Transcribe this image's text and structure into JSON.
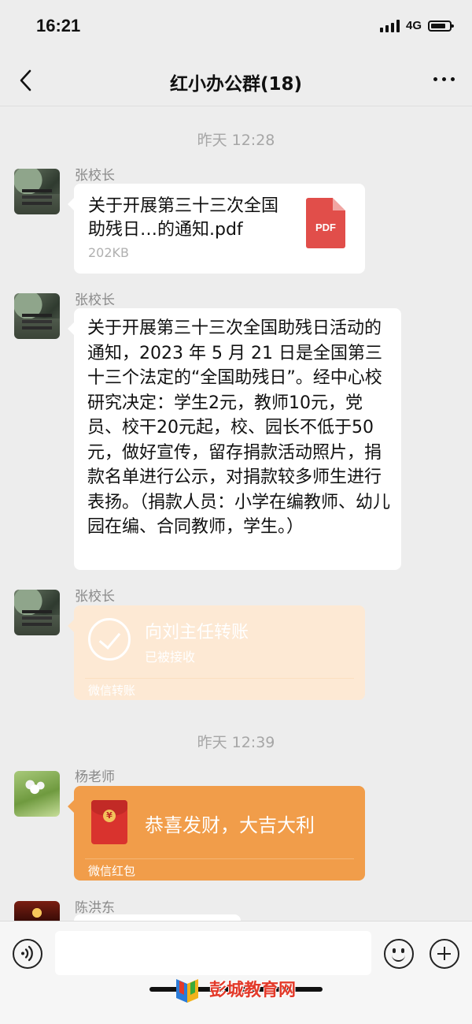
{
  "status_bar": {
    "time": "16:21",
    "network": "4G"
  },
  "header": {
    "title": "红小办公群(18)"
  },
  "messages": [
    {
      "type": "time",
      "text": "昨天 12:28"
    },
    {
      "type": "file",
      "sender": "张校长",
      "file_name": "关于开展第三十三次全国助残日…的通知.pdf",
      "file_size": "202KB",
      "file_icon_label": "PDF",
      "icon": "pdf-file-icon"
    },
    {
      "type": "text",
      "sender": "张校长",
      "text": "关于开展第三十三次全国助残日活动的通知，2023 年 5 月 21 日是全国第三十三个法定的“全国助残日”。经中心校研究决定：学生2元，教师10元，党员、校干20元起，校、园长不低于50元，做好宣传，留存捐款活动照片，捐款名单进行公示，对捐款较多师生进行表扬。（捐款人员：小学在编教师、幼儿园在编、合同教师，学生。）"
    },
    {
      "type": "transfer",
      "sender": "张校长",
      "title": "向刘主任转账",
      "status": "已被接收",
      "footer": "微信转账",
      "icon": "check-circle-icon"
    },
    {
      "type": "time",
      "text": "昨天 12:39"
    },
    {
      "type": "red_packet",
      "sender": "杨老师",
      "title": "恭喜发财，大吉大利",
      "footer": "微信红包",
      "icon": "red-packet-icon",
      "coin_symbol": "¥"
    },
    {
      "type": "partial",
      "sender": "陈洪东"
    }
  ],
  "input_bar": {
    "placeholder": ""
  },
  "watermark": {
    "text": "彭城教育网"
  },
  "colors": {
    "background": "#ededed",
    "transfer": "#fde9d4",
    "red_packet": "#f19d4a",
    "pdf": "#e14e4a"
  }
}
